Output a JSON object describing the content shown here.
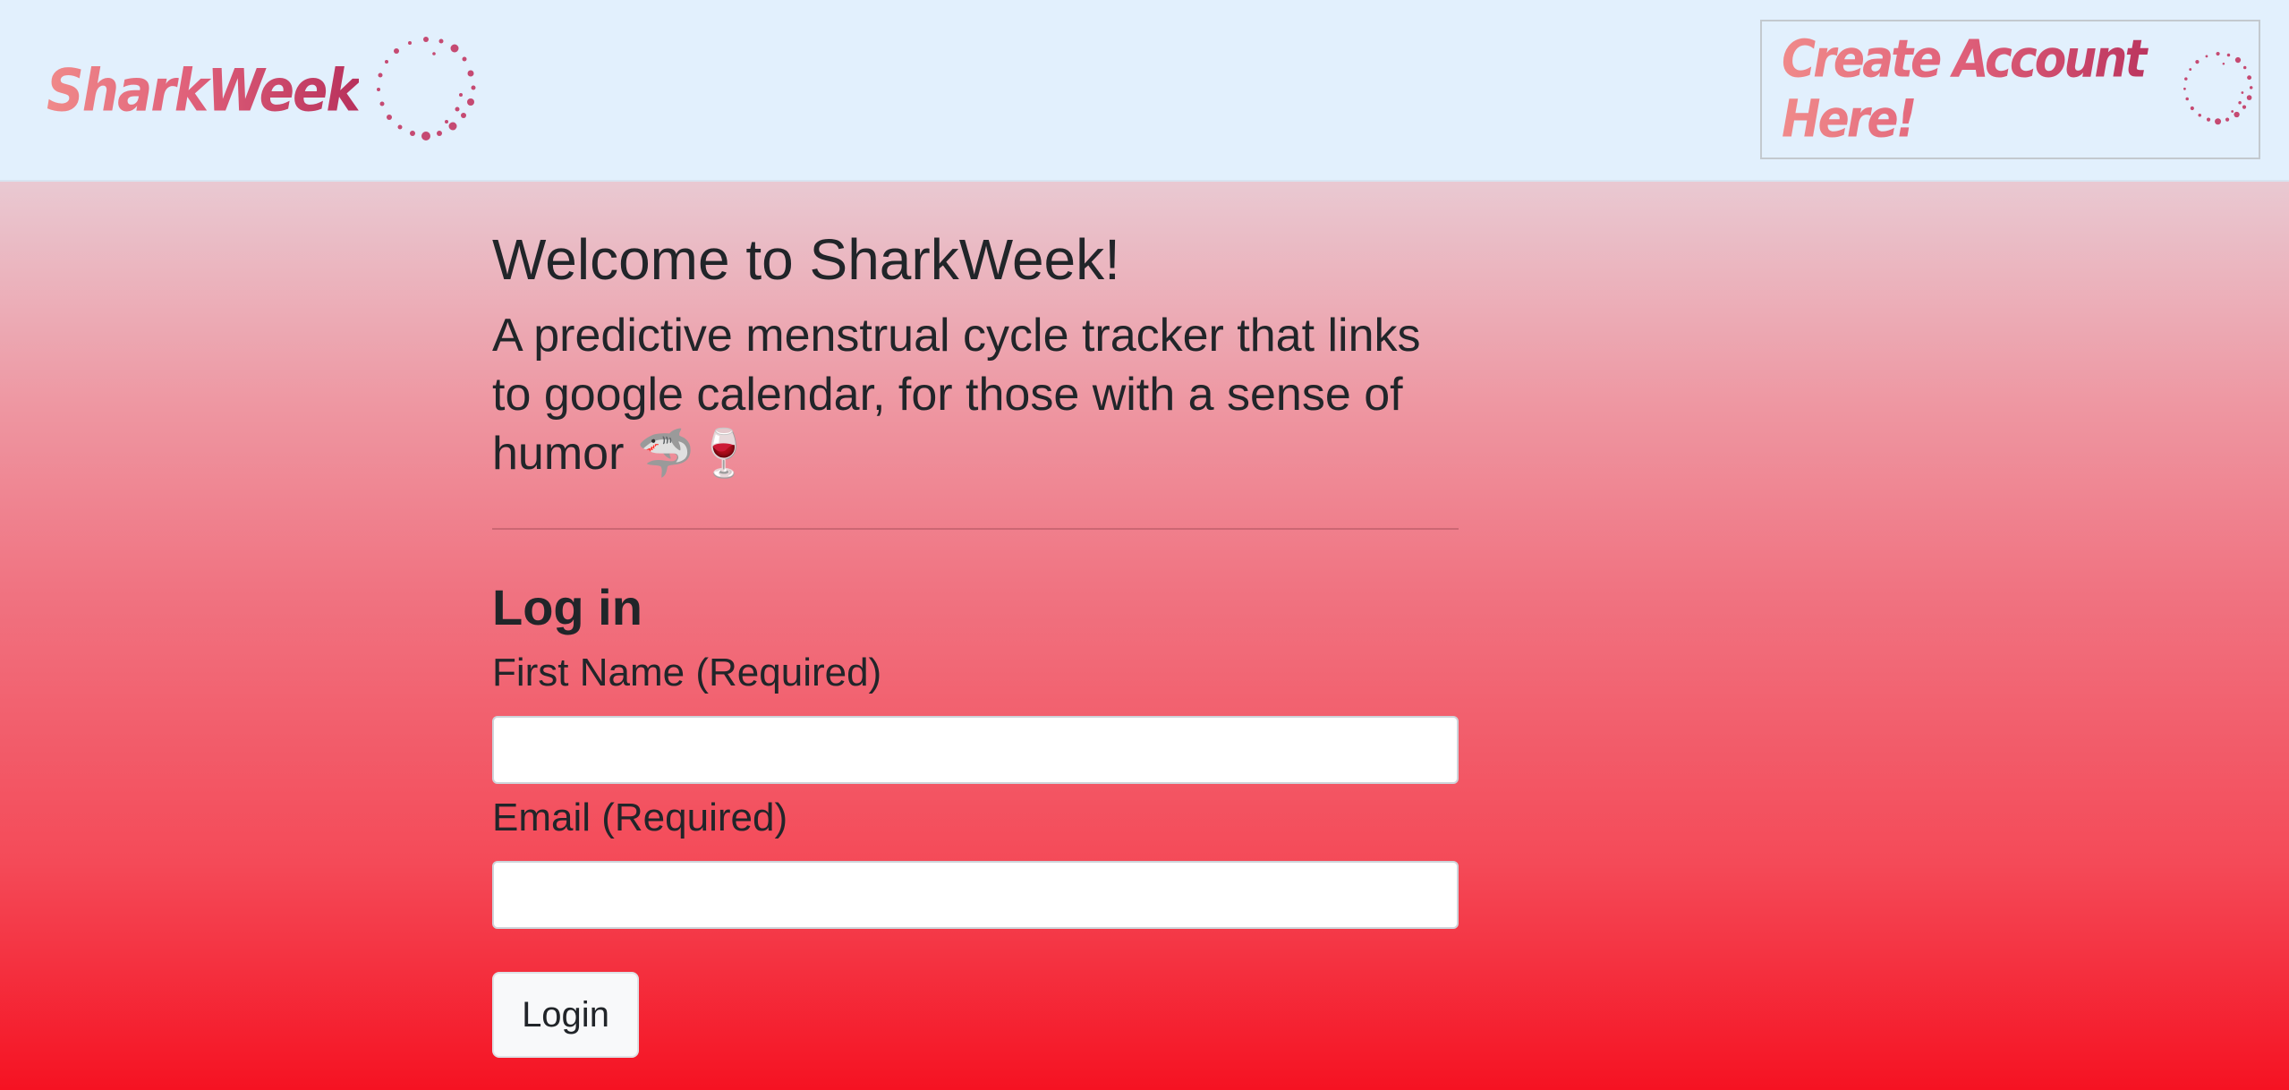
{
  "navbar": {
    "brand": "SharkWeek",
    "create_account": "Create Account Here!"
  },
  "main": {
    "welcome": "Welcome to SharkWeek!",
    "tagline": "A predictive menstrual cycle tracker that links to google calendar, for those with a sense of humor",
    "tagline_emoji": "🦈🍷"
  },
  "login": {
    "title": "Log in",
    "first_name_label": "First Name (Required)",
    "first_name_value": "",
    "email_label": "Email (Required)",
    "email_value": "",
    "submit_label": "Login"
  },
  "colors": {
    "nav_background": "#e2f0fd",
    "brand_gradient": [
      "#f08a8a",
      "#b8315c"
    ],
    "hero_gradient_top": "#e9c9d2",
    "hero_gradient_bottom": "#f51222",
    "text": "#212529"
  }
}
